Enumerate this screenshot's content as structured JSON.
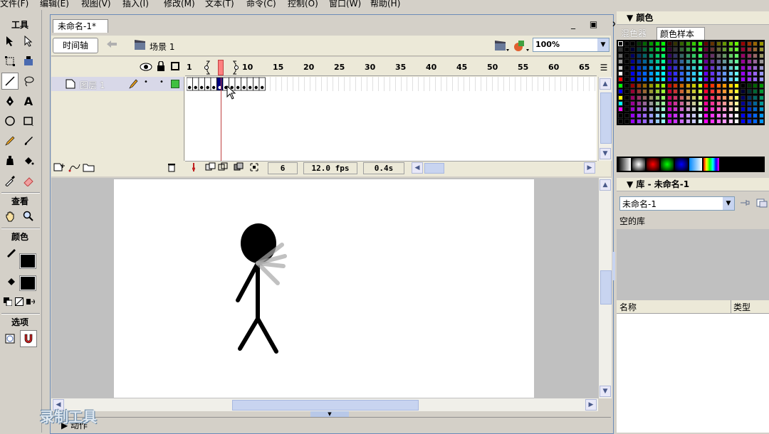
{
  "menu": {
    "items": [
      "文件(F)",
      "编辑(E)",
      "视图(V)",
      "插入(I)",
      "修改(M)",
      "文本(T)",
      "命令(C)",
      "控制(O)",
      "窗口(W)",
      "帮助(H)"
    ]
  },
  "tools": {
    "title": "工具",
    "view_label": "查看",
    "color_label": "颜色",
    "options_label": "选项",
    "text_tool_glyph": "A"
  },
  "document": {
    "tab_title": "未命名-1*",
    "window_controls": "_ ▣ ✕",
    "timeline_button": "时间轴",
    "scene_label": "场景 1",
    "zoom_value": "100%"
  },
  "timeline": {
    "layer_name": "图层 1",
    "ruler_labels": [
      "1",
      "10",
      "15",
      "20",
      "25",
      "30",
      "35",
      "40",
      "45",
      "50",
      "55",
      "60",
      "65"
    ],
    "current_frame": 6,
    "frame_value": "6",
    "fps_value": "12.0 fps",
    "time_value": "0.4s",
    "keyframe_count": 13
  },
  "stage": {
    "background": "#ffffff",
    "figure_color": "#000000"
  },
  "color_panel": {
    "title": "▼ 颜色",
    "tab_mixer": "混色器",
    "tab_swatches": "颜色样本"
  },
  "library_panel": {
    "title": "▼ 库 - 未命名-1",
    "doc_select": "未命名-1",
    "empty_label": "空的库",
    "col_name": "名称",
    "col_type": "类型"
  },
  "watermark": {
    "text": "录制工具"
  },
  "bottom_panel": {
    "title": "▶ 动作"
  },
  "colors": {
    "accent_blue": "#6b8bb8",
    "panel_bg": "#d4d0c8",
    "playhead": "#ff8080",
    "selected_tab": "#ffffff"
  }
}
